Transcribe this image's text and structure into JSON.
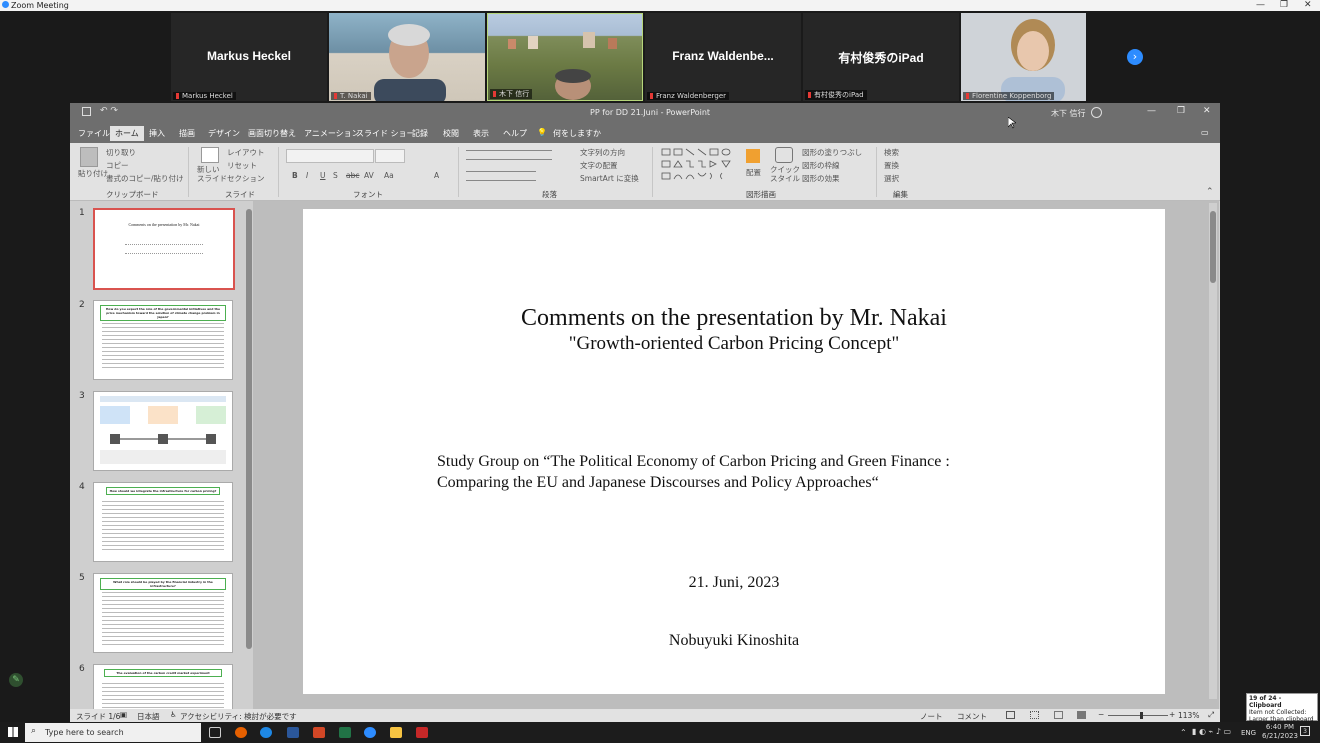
{
  "zoom": {
    "window_title": "Zoom Meeting",
    "minimize": "—",
    "restore": "❐",
    "close": "✕",
    "participants": [
      {
        "big_name": "Markus Heckel",
        "label": "Markus Heckel",
        "video": false
      },
      {
        "big_name": "",
        "label": "T. Nakai",
        "video": true
      },
      {
        "big_name": "",
        "label": "木下 信行",
        "video": true
      },
      {
        "big_name": "Franz  Waldenbe...",
        "label": "Franz Waldenberger",
        "video": false
      },
      {
        "big_name": "有村俊秀のiPad",
        "label": "有村俊秀のiPad",
        "video": false
      },
      {
        "big_name": "",
        "label": "Florentine Koppenborg",
        "video": true
      }
    ],
    "next_label": "›"
  },
  "ppt": {
    "title": "PP for DD 21.Juni  -  PowerPoint",
    "user": "木下 信行",
    "autosave_icons": "↶ ↷",
    "tabs": [
      "ファイル",
      "ホーム",
      "挿入",
      "描画",
      "デザイン",
      "画面切り替え",
      "アニメーション",
      "スライド ショー",
      "記録",
      "校閲",
      "表示",
      "ヘルプ"
    ],
    "tell_me": "何をしますか",
    "ribbon": {
      "clipboard": {
        "paste": "貼り付け",
        "cut": "切り取り",
        "copy": "コピー",
        "format_painter": "書式のコピー/貼り付け",
        "group": "クリップボード"
      },
      "slides": {
        "new_slide": "新しい\nスライド",
        "layout": "レイアウト",
        "reset": "リセット",
        "section": "セクション",
        "group": "スライド"
      },
      "font": {
        "group": "フォント",
        "buttons": [
          "B",
          "I",
          "U",
          "S",
          "abc",
          "AV",
          "Aa",
          "A"
        ]
      },
      "paragraph": {
        "text_direction": "文字列の方向",
        "align_text": "文字の配置",
        "smartart": "SmartArt に変換",
        "group": "段落"
      },
      "drawing": {
        "arrange": "配置",
        "quick_styles": "クイック\nスタイル",
        "shape_fill": "図形の塗りつぶし",
        "shape_outline": "図形の枠線",
        "shape_effects": "図形の効果",
        "group": "図形描画"
      },
      "editing": {
        "find": "検索",
        "replace": "置換",
        "select": "選択",
        "group": "編集"
      }
    },
    "thumbnails": [
      {
        "num": "1",
        "title": "Comments on the presentation by Mr. Nakai",
        "selected": true
      },
      {
        "num": "2",
        "title": "How do you expect the role of the governmental initiatives and the price mechanism toward the solution of climate change problem in Japan?"
      },
      {
        "num": "3",
        "title": ""
      },
      {
        "num": "4",
        "title": "How should we integrate the infrastructure for carbon pricing?"
      },
      {
        "num": "5",
        "title": "What role should be played by the financial industry in the infrastructure?"
      },
      {
        "num": "6",
        "title": "The evaluation of the carbon credit market experiment"
      }
    ],
    "slide": {
      "title": "Comments on the presentation by Mr. Nakai",
      "subtitle": "\"Growth-oriented Carbon Pricing Concept\"",
      "study_line1": "Study Group on “The Political Economy of Carbon Pricing and Green Finance :",
      "study_line2": "Comparing the EU and Japanese Discourses and Policy Approaches“",
      "date": "21.   Juni, 2023",
      "author": "Nobuyuki Kinoshita"
    },
    "status": {
      "slide_count": "スライド 1/6",
      "language": "日本語",
      "accessibility": "アクセシビリティ: 検討が必要です",
      "notes": "ノート",
      "comments": "コメント",
      "zoom": "113%",
      "zoom_fraction": 0.55
    }
  },
  "taskbar": {
    "search_placeholder": "Type here to search",
    "lang": "ENG",
    "time": "6:40 PM",
    "date": "6/21/2023",
    "notif_count": "3"
  },
  "clipboard_toast": {
    "title": "19 of 24 - Clipboard",
    "body": "Item not Collected: Larger than clipboard capacity"
  }
}
